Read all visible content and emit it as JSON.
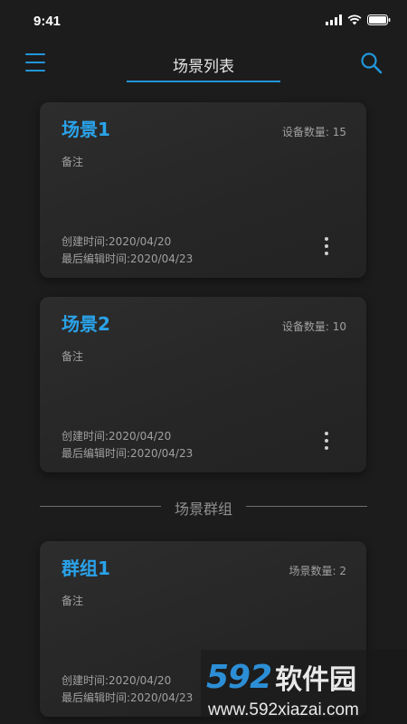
{
  "status_bar": {
    "time": "9:41"
  },
  "header": {
    "title": "场景列表"
  },
  "scenes": [
    {
      "title": "场景1",
      "count_label": "设备数量: 15",
      "note": "备注",
      "created": "创建时间:2020/04/20",
      "edited": "最后编辑时间:2020/04/23"
    },
    {
      "title": "场景2",
      "count_label": "设备数量: 10",
      "note": "备注",
      "created": "创建时间:2020/04/20",
      "edited": "最后编辑时间:2020/04/23"
    }
  ],
  "section": {
    "label": "场景群组"
  },
  "groups": [
    {
      "title": "群组1",
      "count_label": "场景数量: 2",
      "note": "备注",
      "created": "创建时间:2020/04/20",
      "edited": "最后编辑时间:2020/04/23"
    }
  ],
  "watermark": {
    "number": "592",
    "brand": "软件园",
    "url": "www.592xiazai.com"
  },
  "colors": {
    "accent": "#2196d9",
    "title_blue": "#2aa3ea",
    "background": "#1c1c1c",
    "card": "#2a2a2a"
  },
  "icons": {
    "menu": "hamburger-menu-icon",
    "search": "search-icon",
    "more": "more-vertical-icon"
  }
}
